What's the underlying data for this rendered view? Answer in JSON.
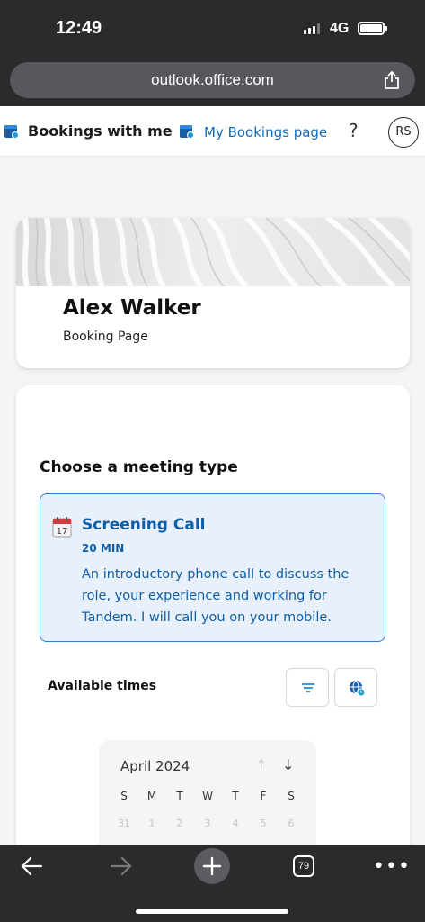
{
  "status": {
    "time": "12:49",
    "network": "4G"
  },
  "browser": {
    "url": "outlook.office.com",
    "tabs_count": "79"
  },
  "header": {
    "title": "Bookings with me",
    "my_bookings_link": "My Bookings page",
    "help_label": "?",
    "avatar_initials": "RS"
  },
  "profile": {
    "name": "Alex Walker",
    "subtitle": "Booking Page"
  },
  "main": {
    "heading": "Choose a meeting type",
    "meeting_type": {
      "name": "Screening Call",
      "duration": "20 MIN",
      "description": "An introductory phone call to discuss the role, your experience and working for Tandem. I will call you on your mobile."
    },
    "available_label": "Available times",
    "calendar": {
      "month": "April 2024",
      "weekdays": [
        "S",
        "M",
        "T",
        "W",
        "T",
        "F",
        "S"
      ],
      "first_row": [
        "31",
        "1",
        "2",
        "3",
        "4",
        "5",
        "6"
      ]
    }
  },
  "colors": {
    "accent": "#0f6cbd",
    "card_bg": "#e8f1fb",
    "chrome": "#2b2b2d"
  }
}
